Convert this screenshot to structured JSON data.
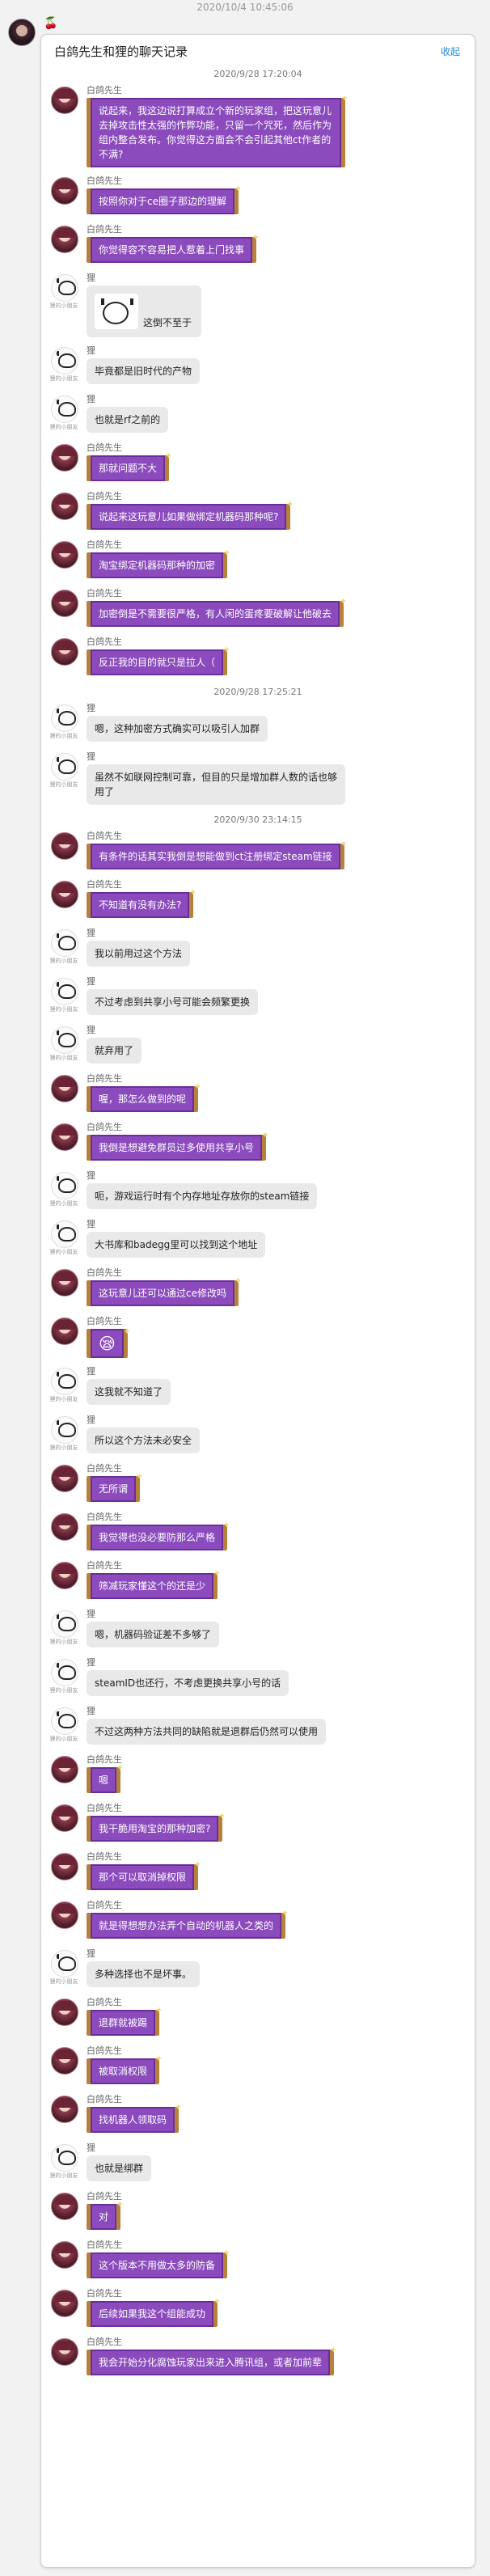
{
  "header": {
    "timestamp": "2020/10/4 10:45:06",
    "sender_icon": "cherry-icon"
  },
  "card": {
    "title": "白鸽先生和狸的聊天记录",
    "collapse_label": "收起"
  },
  "colors": {
    "bubble_purple": "#8b4bbd",
    "bubble_grey": "#e9e9e9",
    "link": "#1e88d8"
  },
  "messages": [
    {
      "kind": "ts",
      "text": "2020/9/28 17:20:04"
    },
    {
      "kind": "msg",
      "who": "girl",
      "name": "白鸽先生",
      "text": "说起来，我这边说打算成立个新的玩家组，把这玩意儿去掉攻击性太强的作弊功能，只留一个咒死，然后作为组内整合发布。你觉得这方面会不会引起其他ct作者的不满?"
    },
    {
      "kind": "msg",
      "who": "girl",
      "name": "白鸽先生",
      "text": "按照你对于ce圈子那边的理解"
    },
    {
      "kind": "msg",
      "who": "girl",
      "name": "白鸽先生",
      "text": "你觉得容不容易把人惹着上门找事"
    },
    {
      "kind": "sticker",
      "who": "bear",
      "name": "狸",
      "text": "这倒不至于"
    },
    {
      "kind": "msg",
      "who": "bear",
      "name": "狸",
      "text": "毕竟都是旧时代的产物"
    },
    {
      "kind": "msg",
      "who": "bear",
      "name": "狸",
      "text": "也就是rf之前的"
    },
    {
      "kind": "msg",
      "who": "girl",
      "name": "白鸽先生",
      "text": "那就问题不大"
    },
    {
      "kind": "msg",
      "who": "girl",
      "name": "白鸽先生",
      "text": "说起来这玩意儿如果做绑定机器码那种呢?"
    },
    {
      "kind": "msg",
      "who": "girl",
      "name": "白鸽先生",
      "text": "淘宝绑定机器码那种的加密"
    },
    {
      "kind": "msg",
      "who": "girl",
      "name": "白鸽先生",
      "text": "加密倒是不需要很严格，有人闲的蛋疼要破解让他破去"
    },
    {
      "kind": "msg",
      "who": "girl",
      "name": "白鸽先生",
      "text": "反正我的目的就只是拉人（"
    },
    {
      "kind": "ts",
      "text": "2020/9/28 17:25:21"
    },
    {
      "kind": "msg",
      "who": "bear",
      "name": "狸",
      "text": "嗯，这种加密方式确实可以吸引人加群"
    },
    {
      "kind": "msg",
      "who": "bear",
      "name": "狸",
      "text": "虽然不如联网控制可靠，但目的只是增加群人数的话也够用了"
    },
    {
      "kind": "ts",
      "text": "2020/9/30 23:14:15"
    },
    {
      "kind": "msg",
      "who": "girl",
      "name": "白鸽先生",
      "text": "有条件的话其实我倒是想能做到ct注册绑定steam链接"
    },
    {
      "kind": "msg",
      "who": "girl",
      "name": "白鸽先生",
      "text": "不知道有没有办法?"
    },
    {
      "kind": "msg",
      "who": "bear",
      "name": "狸",
      "text": "我以前用过这个方法"
    },
    {
      "kind": "msg",
      "who": "bear",
      "name": "狸",
      "text": "不过考虑到共享小号可能会频繁更换"
    },
    {
      "kind": "msg",
      "who": "bear",
      "name": "狸",
      "text": "就弃用了"
    },
    {
      "kind": "msg",
      "who": "girl",
      "name": "白鸽先生",
      "text": "喔，那怎么做到的呢"
    },
    {
      "kind": "msg",
      "who": "girl",
      "name": "白鸽先生",
      "text": "我倒是想避免群员过多使用共享小号"
    },
    {
      "kind": "msg",
      "who": "bear",
      "name": "狸",
      "text": "呃，游戏运行时有个内存地址存放你的steam链接"
    },
    {
      "kind": "msg",
      "who": "bear",
      "name": "狸",
      "text": "大书库和badegg里可以找到这个地址"
    },
    {
      "kind": "msg",
      "who": "girl",
      "name": "白鸽先生",
      "text": "这玩意儿还可以通过ce修改吗"
    },
    {
      "kind": "emoji",
      "who": "girl",
      "name": "白鸽先生",
      "text": "😪"
    },
    {
      "kind": "msg",
      "who": "bear",
      "name": "狸",
      "text": "这我就不知道了"
    },
    {
      "kind": "msg",
      "who": "bear",
      "name": "狸",
      "text": "所以这个方法未必安全"
    },
    {
      "kind": "msg",
      "who": "girl",
      "name": "白鸽先生",
      "text": "无所谓"
    },
    {
      "kind": "msg",
      "who": "girl",
      "name": "白鸽先生",
      "text": "我觉得也没必要防那么严格"
    },
    {
      "kind": "msg",
      "who": "girl",
      "name": "白鸽先生",
      "text": "筛减玩家懂这个的还是少"
    },
    {
      "kind": "msg",
      "who": "bear",
      "name": "狸",
      "text": "嗯，机器码验证差不多够了"
    },
    {
      "kind": "msg",
      "who": "bear",
      "name": "狸",
      "text": "steamID也还行，不考虑更换共享小号的话"
    },
    {
      "kind": "msg",
      "who": "bear",
      "name": "狸",
      "text": "不过这两种方法共同的缺陷就是退群后仍然可以使用"
    },
    {
      "kind": "msg",
      "who": "girl",
      "name": "白鸽先生",
      "text": "嗯"
    },
    {
      "kind": "msg",
      "who": "girl",
      "name": "白鸽先生",
      "text": "我干脆用淘宝的那种加密?"
    },
    {
      "kind": "msg",
      "who": "girl",
      "name": "白鸽先生",
      "text": "那个可以取消掉权限"
    },
    {
      "kind": "msg",
      "who": "girl",
      "name": "白鸽先生",
      "text": "就是得想想办法弄个自动的机器人之类的"
    },
    {
      "kind": "msg",
      "who": "bear",
      "name": "狸",
      "text": "多种选择也不是坏事。"
    },
    {
      "kind": "msg",
      "who": "girl",
      "name": "白鸽先生",
      "text": "退群就被踢"
    },
    {
      "kind": "msg",
      "who": "girl",
      "name": "白鸽先生",
      "text": "被取消权限"
    },
    {
      "kind": "msg",
      "who": "girl",
      "name": "白鸽先生",
      "text": "找机器人领取码"
    },
    {
      "kind": "msg",
      "who": "bear",
      "name": "狸",
      "text": "也就是绑群"
    },
    {
      "kind": "msg",
      "who": "girl",
      "name": "白鸽先生",
      "text": "对"
    },
    {
      "kind": "msg",
      "who": "girl",
      "name": "白鸽先生",
      "text": "这个版本不用做太多的防备"
    },
    {
      "kind": "msg",
      "who": "girl",
      "name": "白鸽先生",
      "text": "后续如果我这个组能成功"
    },
    {
      "kind": "msg",
      "who": "girl",
      "name": "白鸽先生",
      "text": "我会开始分化腐蚀玩家出来进入腾讯组，或者加前辈"
    }
  ],
  "bear_tag": "狸的小朋友"
}
